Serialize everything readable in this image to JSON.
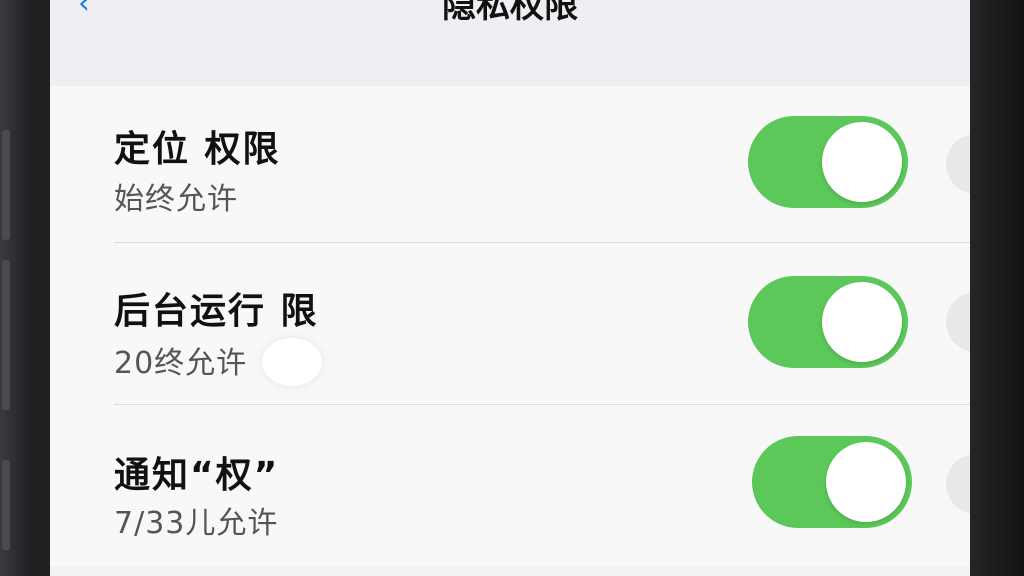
{
  "navbar": {
    "title": "隐私权限",
    "back_icon": "chevron-left-icon"
  },
  "settings": [
    {
      "title": "定位 权限",
      "subtitle": "始终允许",
      "enabled": true
    },
    {
      "title": "后台运行 限",
      "subtitle": "20终允许",
      "enabled": true
    },
    {
      "title": "通知“权”",
      "subtitle": "7/33儿允许",
      "enabled": true
    }
  ],
  "colors": {
    "toggle_on": "#5cc85a",
    "back_accent": "#1a7fe0",
    "background": "#f8f8f8"
  }
}
